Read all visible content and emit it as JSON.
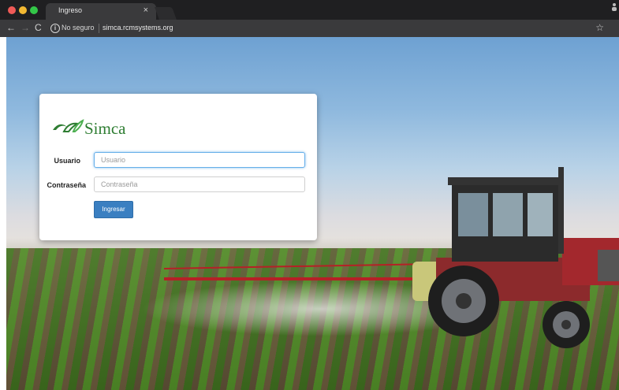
{
  "browser": {
    "tab_title": "Ingreso",
    "tab_close": "×",
    "security_label": "No seguro",
    "url": "simca.rcmsystems.org",
    "nav_back": "←",
    "nav_forward": "→",
    "nav_reload": "C",
    "bookmark_star": "☆"
  },
  "login": {
    "brand": "Simca",
    "user_label": "Usuario",
    "user_placeholder": "Usuario",
    "pass_label": "Contraseña",
    "pass_placeholder": "Contraseña",
    "submit_label": "Ingresar"
  },
  "icons": [
    "info-icon",
    "leaf-logo-icon",
    "star-icon",
    "close-icon"
  ],
  "colors": {
    "brand_green": "#2e7d32",
    "button_blue": "#3a7fc1",
    "focus_blue": "#66afe9"
  }
}
